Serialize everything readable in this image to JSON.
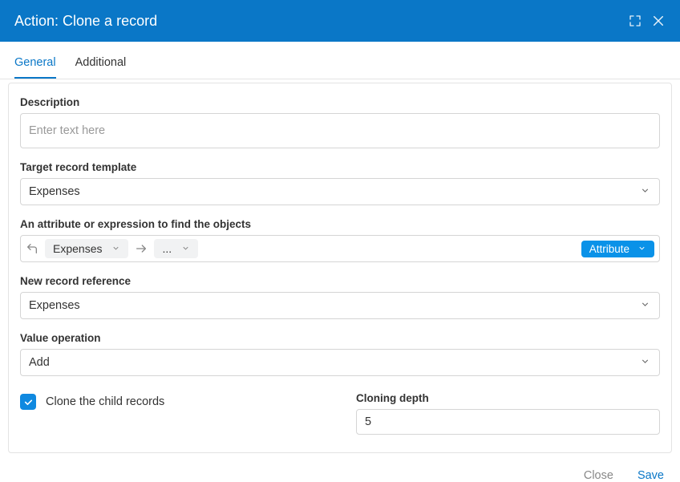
{
  "header": {
    "title": "Action: Clone a record"
  },
  "tabs": [
    {
      "label": "General",
      "active": true
    },
    {
      "label": "Additional",
      "active": false
    }
  ],
  "fields": {
    "description": {
      "label": "Description",
      "placeholder": "Enter text here",
      "value": ""
    },
    "target_template": {
      "label": "Target record template",
      "value": "Expenses"
    },
    "find_expr": {
      "label": "An attribute or expression to find the objects",
      "chip_value": "Expenses",
      "ellipsis": "...",
      "badge_label": "Attribute"
    },
    "new_ref": {
      "label": "New record reference",
      "value": "Expenses"
    },
    "value_op": {
      "label": "Value operation",
      "value": "Add"
    },
    "clone_children": {
      "label": "Clone the child records",
      "checked": true
    },
    "cloning_depth": {
      "label": "Cloning depth",
      "value": "5"
    }
  },
  "footer": {
    "close": "Close",
    "save": "Save"
  }
}
